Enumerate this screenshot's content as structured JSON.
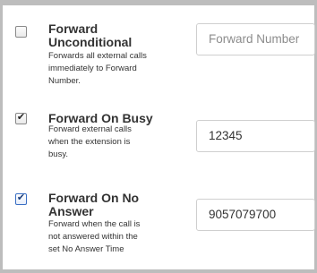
{
  "forwarding": [
    {
      "title": "Forward Unconditional",
      "title_line1": "Forward",
      "title_line2": "Unconditional",
      "description_lines": [
        "Forwards all external calls",
        "immediately to Forward",
        "Number."
      ],
      "checked": false,
      "input_value": "",
      "input_placeholder": "Forward Number"
    },
    {
      "title": "Forward On Busy",
      "description_lines": [
        "Forward external calls",
        "when the extension is",
        "busy."
      ],
      "checked": true,
      "input_value": "12345",
      "input_placeholder": ""
    },
    {
      "title": "Forward On No Answer",
      "title_line1": "Forward On No",
      "title_line2": "Answer",
      "description_lines": [
        "Forward when the call is",
        "not answered within the",
        "set No Answer Time"
      ],
      "checked": true,
      "input_value": "9057079700",
      "input_placeholder": ""
    }
  ],
  "check_glyph": "✔",
  "colors": {
    "frame": "#bdbdbd",
    "text": "#333333",
    "input_border": "#cfcfcf",
    "placeholder": "#8c8c8c"
  }
}
